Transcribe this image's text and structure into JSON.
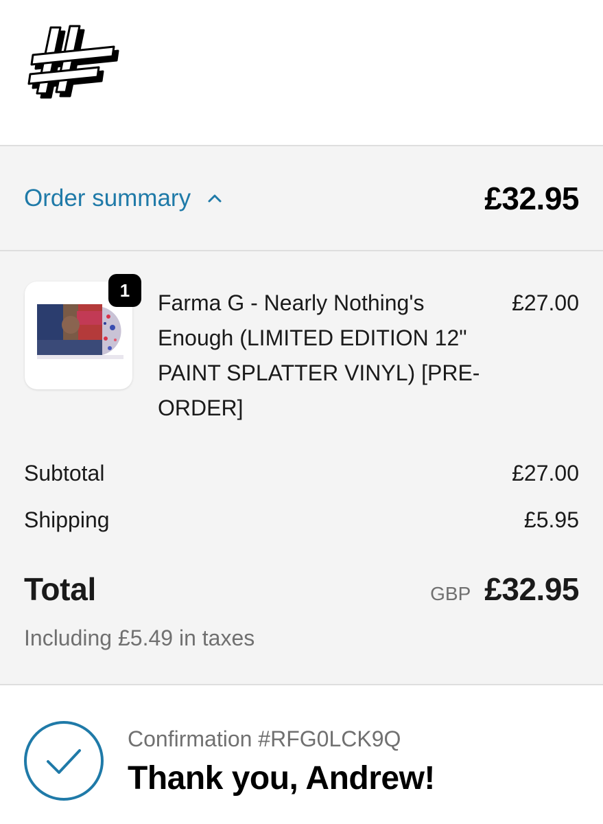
{
  "summary": {
    "toggle_label": "Order summary",
    "total": "£32.95"
  },
  "item": {
    "quantity": "1",
    "title": "Farma G - Nearly Nothing's Enough (LIMITED EDITION 12\" PAINT SPLATTER VINYL) [PRE-ORDER]",
    "price": "£27.00"
  },
  "totals": {
    "subtotal_label": "Subtotal",
    "subtotal_value": "£27.00",
    "shipping_label": "Shipping",
    "shipping_value": "£5.95",
    "total_label": "Total",
    "currency": "GBP",
    "total_value": "£32.95",
    "taxes_note": "Including £5.49 in taxes"
  },
  "confirmation": {
    "number": "Confirmation #RFG0LCK9Q",
    "thank_you": "Thank you, Andrew!"
  },
  "colors": {
    "accent": "#1f7aa8",
    "panel_bg": "#f4f4f4",
    "muted_text": "#707070"
  },
  "icons": {
    "logo": "brand-logo-icon",
    "toggle": "chevron-up-icon",
    "confirm": "check-circle-icon"
  }
}
